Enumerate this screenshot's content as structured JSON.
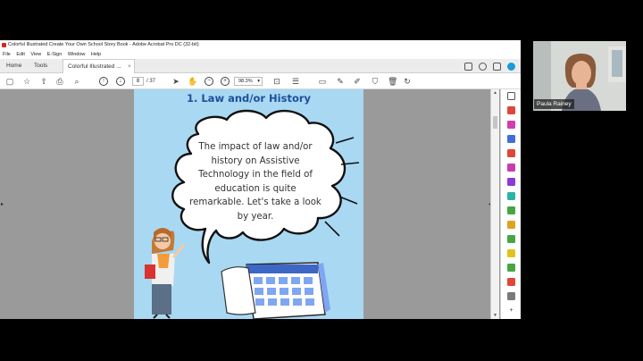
{
  "window": {
    "title": "Colorful Illustrated Create Your Own School Story Book - Adobe Acrobat Pro DC (32-bit)",
    "menu": [
      "File",
      "Edit",
      "View",
      "E-Sign",
      "Window",
      "Help"
    ]
  },
  "tabs": {
    "home": "Home",
    "tools": "Tools",
    "document": "Colorful Illustrated ...",
    "close": "×"
  },
  "toolbar": {
    "current_page": "8",
    "page_count": "/ 37",
    "zoom": "98.3%"
  },
  "page": {
    "title": "1. Law and/or History",
    "bubble_text": "The impact of law and/or history on Assistive Technology in the field of education is quite remarkable.  Let's take a look by year."
  },
  "webcam": {
    "participant_name": "Paula Rainey"
  },
  "colors": {
    "page_background": "#a9d8f2",
    "title_color": "#1e4f9a",
    "viewer_background": "#9a9a9a"
  }
}
